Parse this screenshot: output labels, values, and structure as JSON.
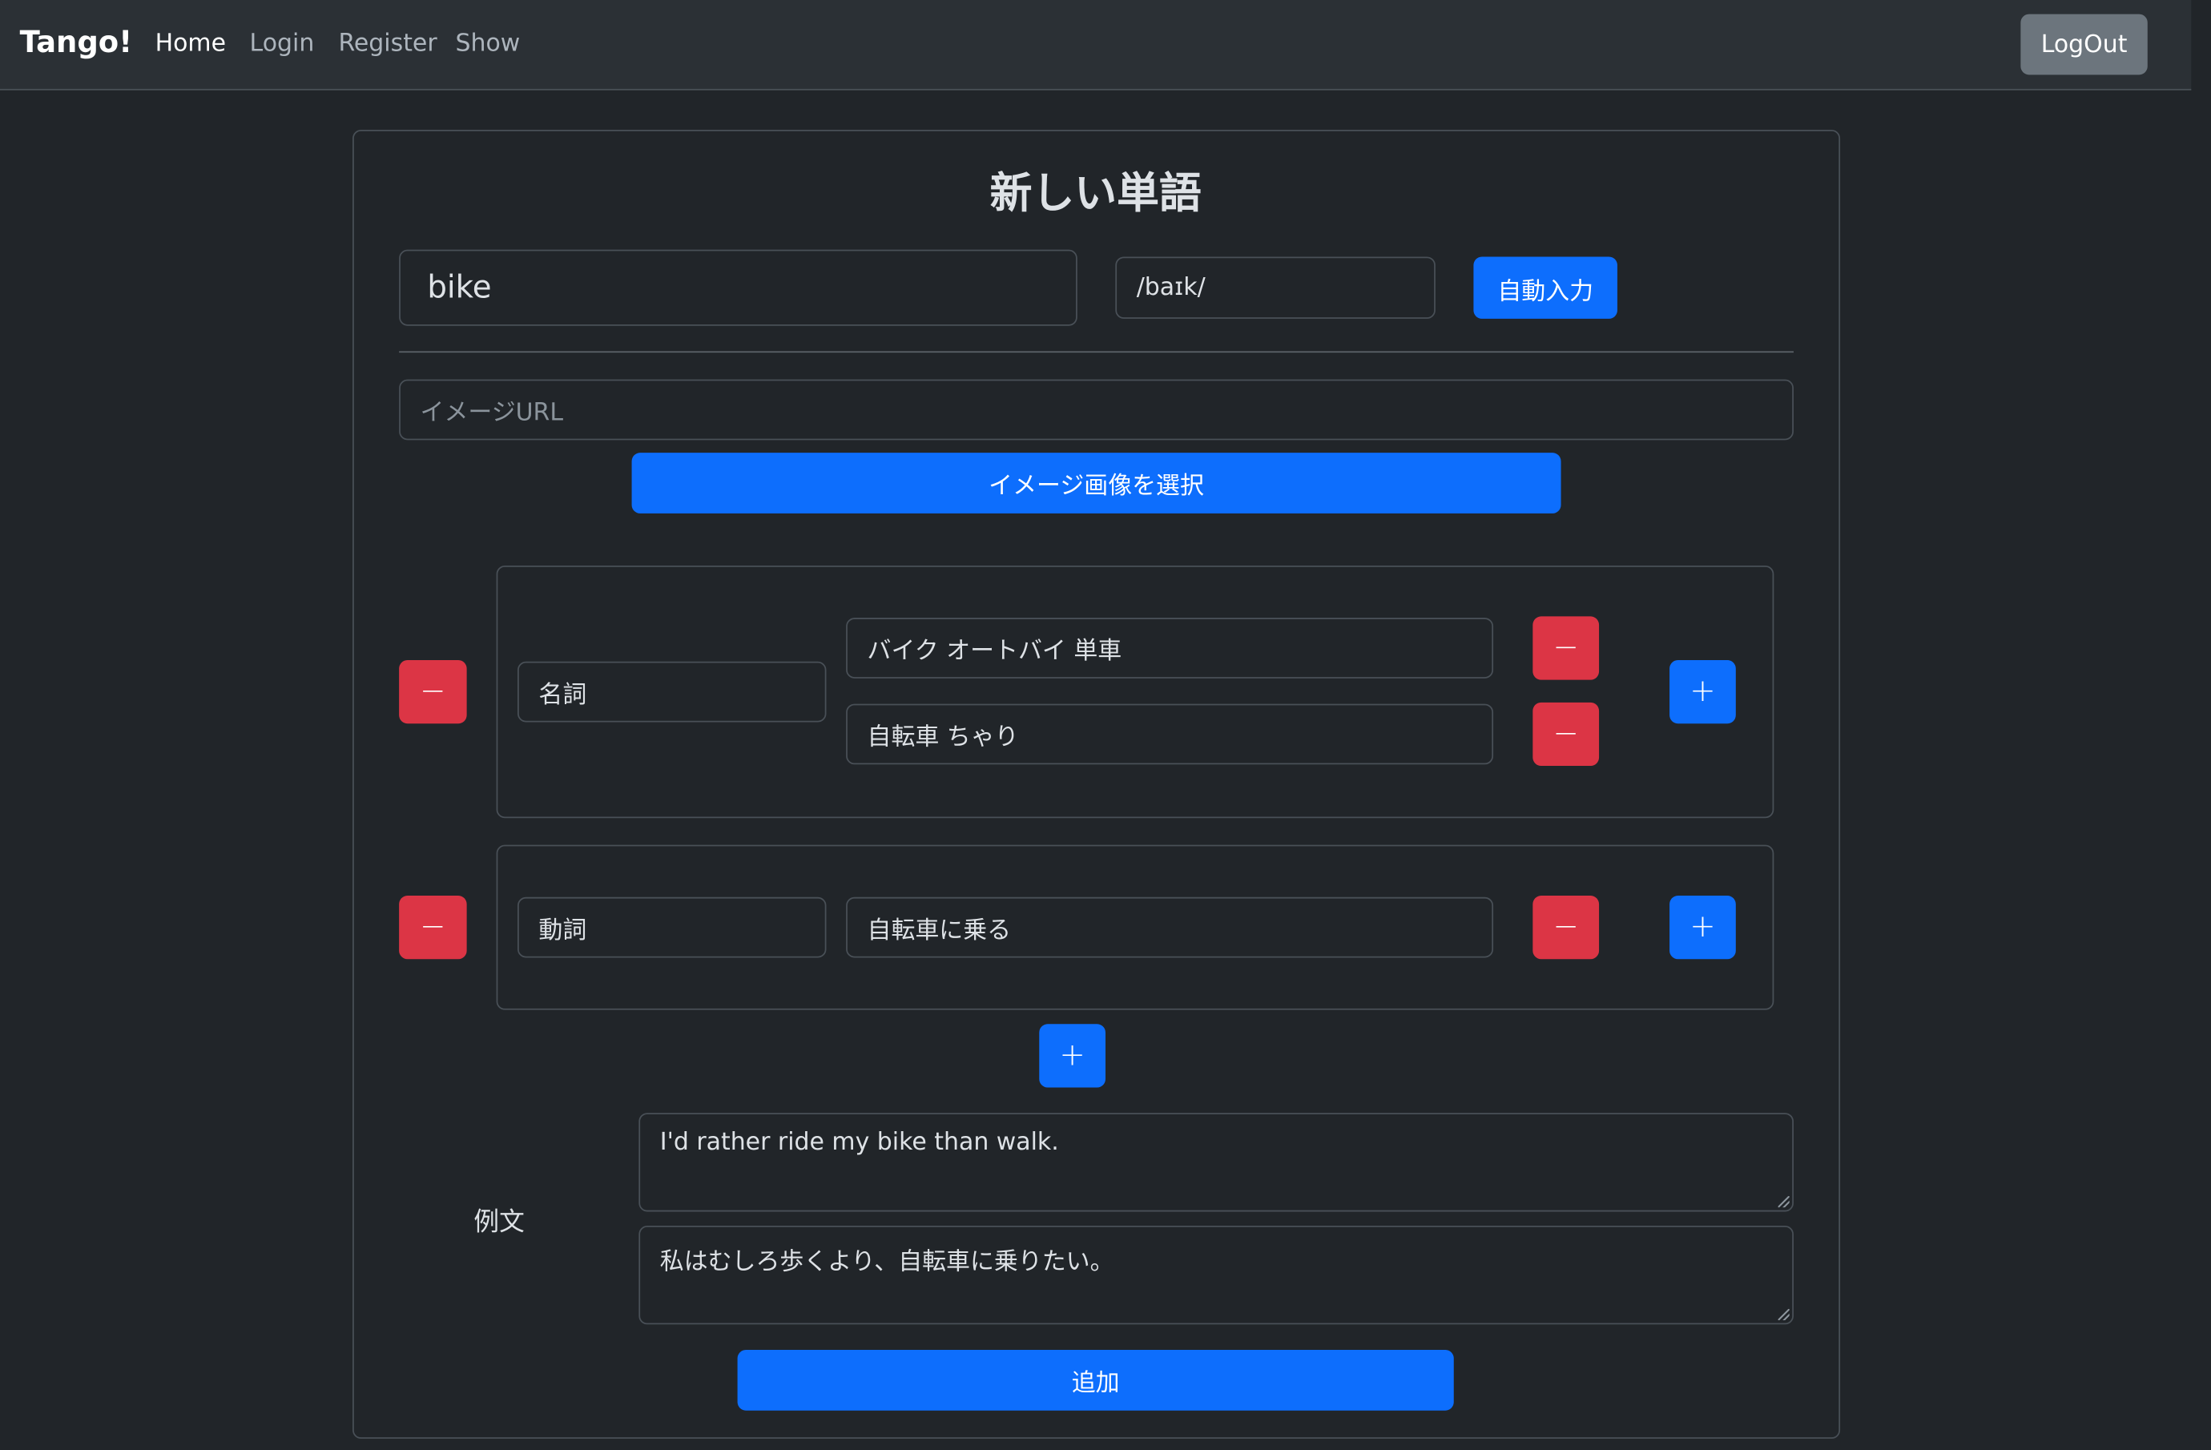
{
  "navbar": {
    "brand": "Tango!",
    "links": [
      {
        "label": "Home"
      },
      {
        "label": "Login"
      },
      {
        "label": "Register"
      },
      {
        "label": "Show"
      }
    ],
    "logout_label": "LogOut"
  },
  "form": {
    "title": "新しい単語",
    "word_value": "bike",
    "pronunciation_value": "/baɪk/",
    "auto_fill_label": "自動入力",
    "image_url_placeholder": "イメージURL",
    "select_image_label": "イメージ画像を選択",
    "meaning_groups": [
      {
        "part_of_speech": "名詞",
        "meanings": [
          "バイク オートバイ 単車",
          "自転車 ちゃり"
        ]
      },
      {
        "part_of_speech": "動詞",
        "meanings": [
          "自転車に乗る"
        ]
      }
    ],
    "minus_icon": "−",
    "plus_icon": "+",
    "examples_label": "例文",
    "example_en": "I'd rather ride my bike than walk.",
    "example_ja": "私はむしろ歩くより、自転車に乗りたい。",
    "submit_label": "追加"
  },
  "colors": {
    "background": "#212529",
    "navbar": "#2b3035",
    "primary": "#0d6efd",
    "danger": "#dc3545",
    "secondary": "#6c757d"
  }
}
